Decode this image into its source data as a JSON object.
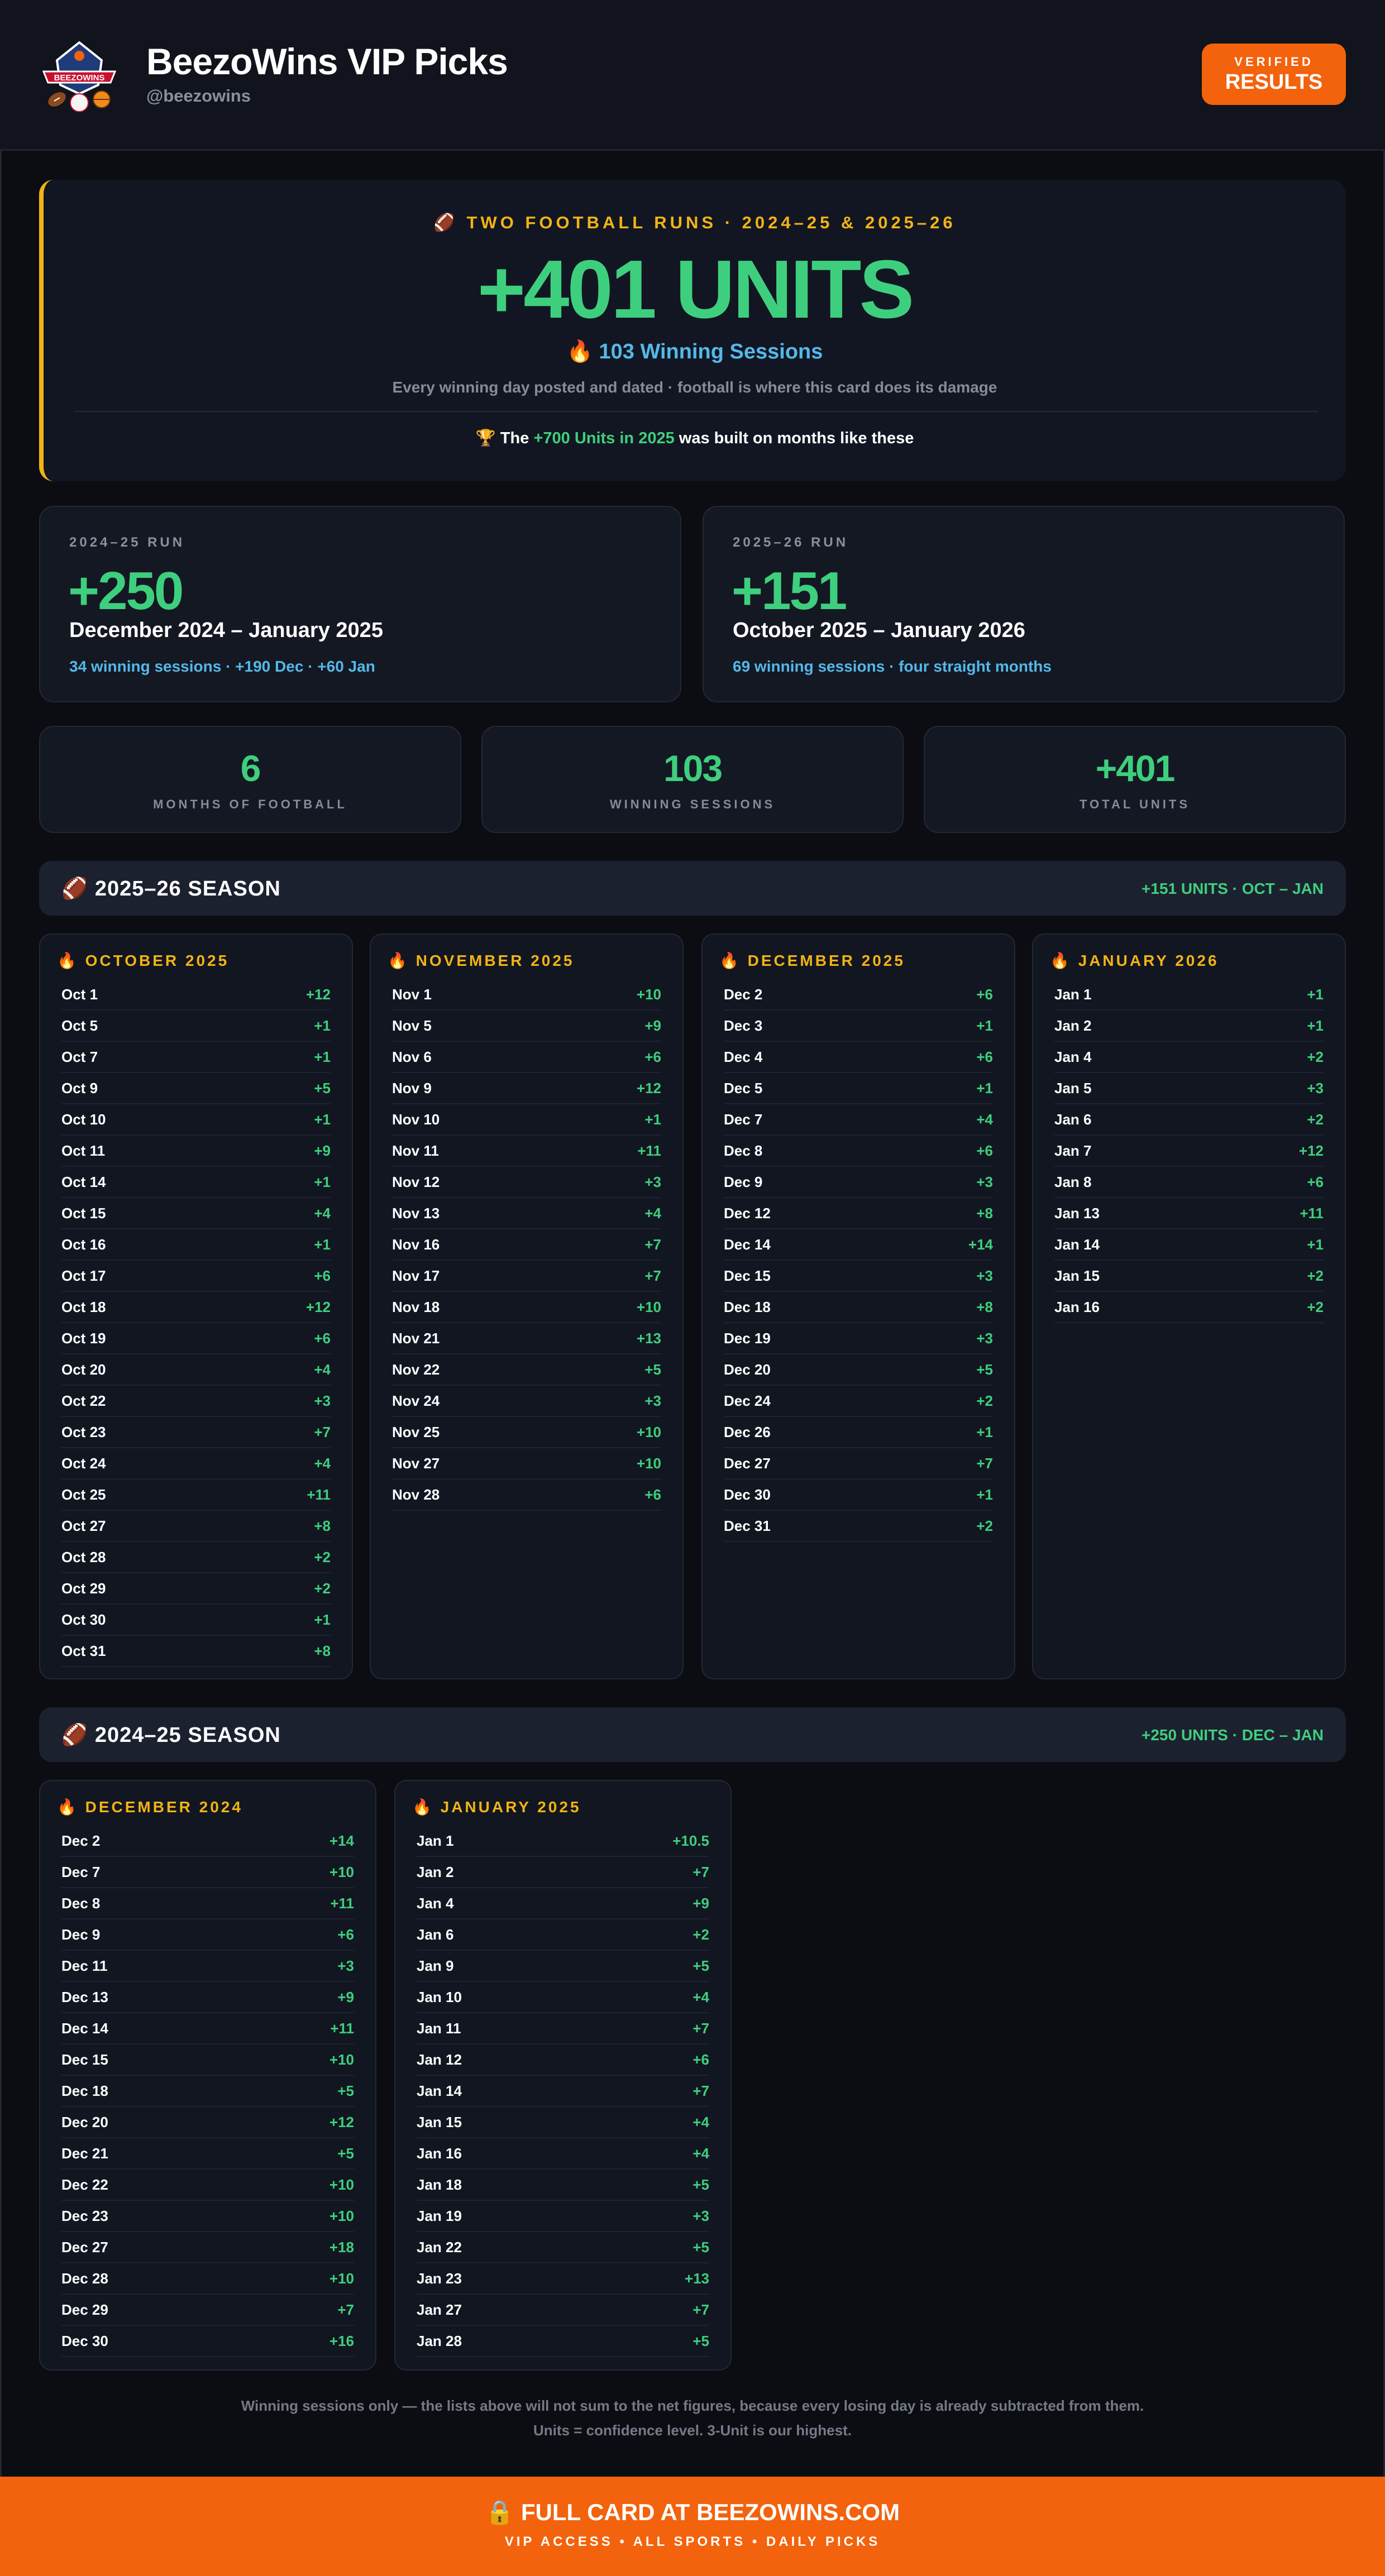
{
  "header": {
    "title": "BeezoWins VIP Picks",
    "handle": "@beezowins",
    "logo_text": "BEEZOWINS",
    "verified_top": "VERIFIED",
    "verified_bottom": "RESULTS"
  },
  "hero": {
    "eyebrow": "🏈 TWO FOOTBALL RUNS · 2024–25 & 2025–26",
    "units": "+401 UNITS",
    "sessions": "🔥 103 Winning Sessions",
    "subtitle": "Every winning day posted and dated · football is where this card does its damage",
    "footer_prefix": "🏆 The",
    "footer_highlight": "+700 Units in 2025",
    "footer_suffix": "was built on months like these"
  },
  "runs": [
    {
      "label": "2024–25 RUN",
      "value": "+250",
      "period": "December 2024 – January 2025",
      "detail": "34 winning sessions · +190 Dec · +60 Jan"
    },
    {
      "label": "2025–26 RUN",
      "value": "+151",
      "period": "October 2025 – January 2026",
      "detail": "69 winning sessions · four straight months"
    }
  ],
  "stats": [
    {
      "value": "6",
      "label": "MONTHS OF FOOTBALL"
    },
    {
      "value": "103",
      "label": "WINNING SESSIONS"
    },
    {
      "value": "+401",
      "label": "TOTAL UNITS"
    }
  ],
  "seasons": [
    {
      "title": "🏈 2025–26 SEASON",
      "summary": "+151 UNITS · OCT – JAN",
      "months": [
        {
          "title": "🔥 OCTOBER 2025",
          "days": [
            [
              "Oct 1",
              "+12"
            ],
            [
              "Oct 5",
              "+1"
            ],
            [
              "Oct 7",
              "+1"
            ],
            [
              "Oct 9",
              "+5"
            ],
            [
              "Oct 10",
              "+1"
            ],
            [
              "Oct 11",
              "+9"
            ],
            [
              "Oct 14",
              "+1"
            ],
            [
              "Oct 15",
              "+4"
            ],
            [
              "Oct 16",
              "+1"
            ],
            [
              "Oct 17",
              "+6"
            ],
            [
              "Oct 18",
              "+12"
            ],
            [
              "Oct 19",
              "+6"
            ],
            [
              "Oct 20",
              "+4"
            ],
            [
              "Oct 22",
              "+3"
            ],
            [
              "Oct 23",
              "+7"
            ],
            [
              "Oct 24",
              "+4"
            ],
            [
              "Oct 25",
              "+11"
            ],
            [
              "Oct 27",
              "+8"
            ],
            [
              "Oct 28",
              "+2"
            ],
            [
              "Oct 29",
              "+2"
            ],
            [
              "Oct 30",
              "+1"
            ],
            [
              "Oct 31",
              "+8"
            ]
          ]
        },
        {
          "title": "🔥 NOVEMBER 2025",
          "days": [
            [
              "Nov 1",
              "+10"
            ],
            [
              "Nov 5",
              "+9"
            ],
            [
              "Nov 6",
              "+6"
            ],
            [
              "Nov 9",
              "+12"
            ],
            [
              "Nov 10",
              "+1"
            ],
            [
              "Nov 11",
              "+11"
            ],
            [
              "Nov 12",
              "+3"
            ],
            [
              "Nov 13",
              "+4"
            ],
            [
              "Nov 16",
              "+7"
            ],
            [
              "Nov 17",
              "+7"
            ],
            [
              "Nov 18",
              "+10"
            ],
            [
              "Nov 21",
              "+13"
            ],
            [
              "Nov 22",
              "+5"
            ],
            [
              "Nov 24",
              "+3"
            ],
            [
              "Nov 25",
              "+10"
            ],
            [
              "Nov 27",
              "+10"
            ],
            [
              "Nov 28",
              "+6"
            ]
          ]
        },
        {
          "title": "🔥 DECEMBER 2025",
          "days": [
            [
              "Dec 2",
              "+6"
            ],
            [
              "Dec 3",
              "+1"
            ],
            [
              "Dec 4",
              "+6"
            ],
            [
              "Dec 5",
              "+1"
            ],
            [
              "Dec 7",
              "+4"
            ],
            [
              "Dec 8",
              "+6"
            ],
            [
              "Dec 9",
              "+3"
            ],
            [
              "Dec 12",
              "+8"
            ],
            [
              "Dec 14",
              "+14"
            ],
            [
              "Dec 15",
              "+3"
            ],
            [
              "Dec 18",
              "+8"
            ],
            [
              "Dec 19",
              "+3"
            ],
            [
              "Dec 20",
              "+5"
            ],
            [
              "Dec 24",
              "+2"
            ],
            [
              "Dec 26",
              "+1"
            ],
            [
              "Dec 27",
              "+7"
            ],
            [
              "Dec 30",
              "+1"
            ],
            [
              "Dec 31",
              "+2"
            ]
          ]
        },
        {
          "title": "🔥 JANUARY 2026",
          "days": [
            [
              "Jan 1",
              "+1"
            ],
            [
              "Jan 2",
              "+1"
            ],
            [
              "Jan 4",
              "+2"
            ],
            [
              "Jan 5",
              "+3"
            ],
            [
              "Jan 6",
              "+2"
            ],
            [
              "Jan 7",
              "+12"
            ],
            [
              "Jan 8",
              "+6"
            ],
            [
              "Jan 13",
              "+11"
            ],
            [
              "Jan 14",
              "+1"
            ],
            [
              "Jan 15",
              "+2"
            ],
            [
              "Jan 16",
              "+2"
            ]
          ]
        }
      ]
    },
    {
      "title": "🏈 2024–25 SEASON",
      "summary": "+250 UNITS · DEC – JAN",
      "months": [
        {
          "title": "🔥 DECEMBER 2024",
          "days": [
            [
              "Dec 2",
              "+14"
            ],
            [
              "Dec 7",
              "+10"
            ],
            [
              "Dec 8",
              "+11"
            ],
            [
              "Dec 9",
              "+6"
            ],
            [
              "Dec 11",
              "+3"
            ],
            [
              "Dec 13",
              "+9"
            ],
            [
              "Dec 14",
              "+11"
            ],
            [
              "Dec 15",
              "+10"
            ],
            [
              "Dec 18",
              "+5"
            ],
            [
              "Dec 20",
              "+12"
            ],
            [
              "Dec 21",
              "+5"
            ],
            [
              "Dec 22",
              "+10"
            ],
            [
              "Dec 23",
              "+10"
            ],
            [
              "Dec 27",
              "+18"
            ],
            [
              "Dec 28",
              "+10"
            ],
            [
              "Dec 29",
              "+7"
            ],
            [
              "Dec 30",
              "+16"
            ]
          ]
        },
        {
          "title": "🔥 JANUARY 2025",
          "days": [
            [
              "Jan 1",
              "+10.5"
            ],
            [
              "Jan 2",
              "+7"
            ],
            [
              "Jan 4",
              "+9"
            ],
            [
              "Jan 6",
              "+2"
            ],
            [
              "Jan 9",
              "+5"
            ],
            [
              "Jan 10",
              "+4"
            ],
            [
              "Jan 11",
              "+7"
            ],
            [
              "Jan 12",
              "+6"
            ],
            [
              "Jan 14",
              "+7"
            ],
            [
              "Jan 15",
              "+4"
            ],
            [
              "Jan 16",
              "+4"
            ],
            [
              "Jan 18",
              "+5"
            ],
            [
              "Jan 19",
              "+3"
            ],
            [
              "Jan 22",
              "+5"
            ],
            [
              "Jan 23",
              "+13"
            ],
            [
              "Jan 27",
              "+7"
            ],
            [
              "Jan 28",
              "+5"
            ]
          ]
        }
      ]
    }
  ],
  "notes": [
    "Winning sessions only — the lists above will not sum to the net figures, because every losing day is already subtracted from them.",
    "Units = confidence level. 3-Unit is our highest."
  ],
  "footer": {
    "cta": "🔒 FULL CARD AT BEEZOWINS.COM",
    "tagline": "VIP ACCESS • ALL SPORTS • DAILY PICKS"
  },
  "colors": {
    "background": "#0b0d12",
    "accent_orange": "#f3620c",
    "positive_green": "#3ecf7e",
    "gold": "#f2b414",
    "info_blue": "#54b8e8"
  }
}
